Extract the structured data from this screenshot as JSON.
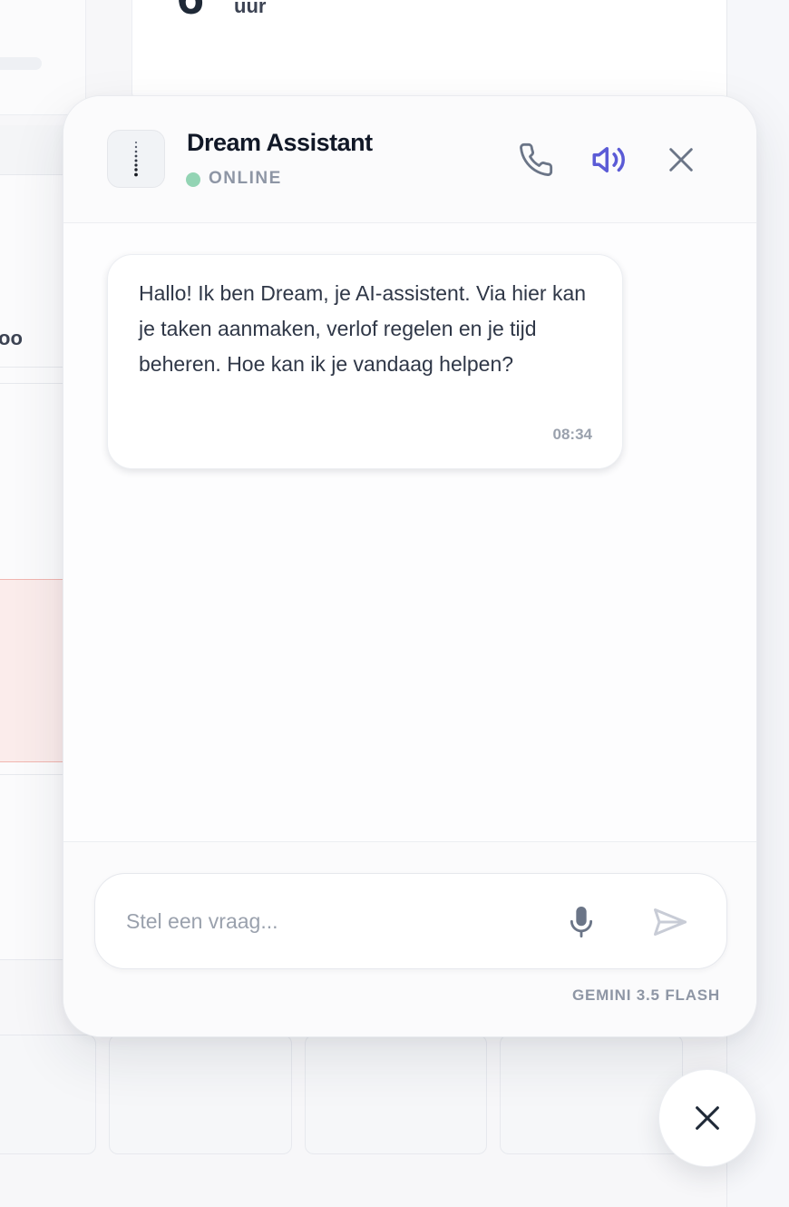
{
  "background": {
    "hours_unit": "uur",
    "partial_label": "oo"
  },
  "chat": {
    "assistant_name": "Dream Assistant",
    "status": "ONLINE",
    "status_color": "#93d4b4",
    "accent_color": "#5b5bd6",
    "header_icons": [
      "phone-icon",
      "speaker-icon",
      "close-icon"
    ],
    "messages": [
      {
        "sender": "assistant",
        "text": "Hallo! Ik ben Dream, je AI-assistent. Via hier kan je taken aanmaken, verlof regelen en je tijd beheren. Hoe kan ik je vandaag helpen?",
        "time": "08:34"
      }
    ],
    "input": {
      "placeholder": "Stel een vraag...",
      "value": ""
    },
    "model_label": "GEMINI 3.5 FLASH"
  }
}
